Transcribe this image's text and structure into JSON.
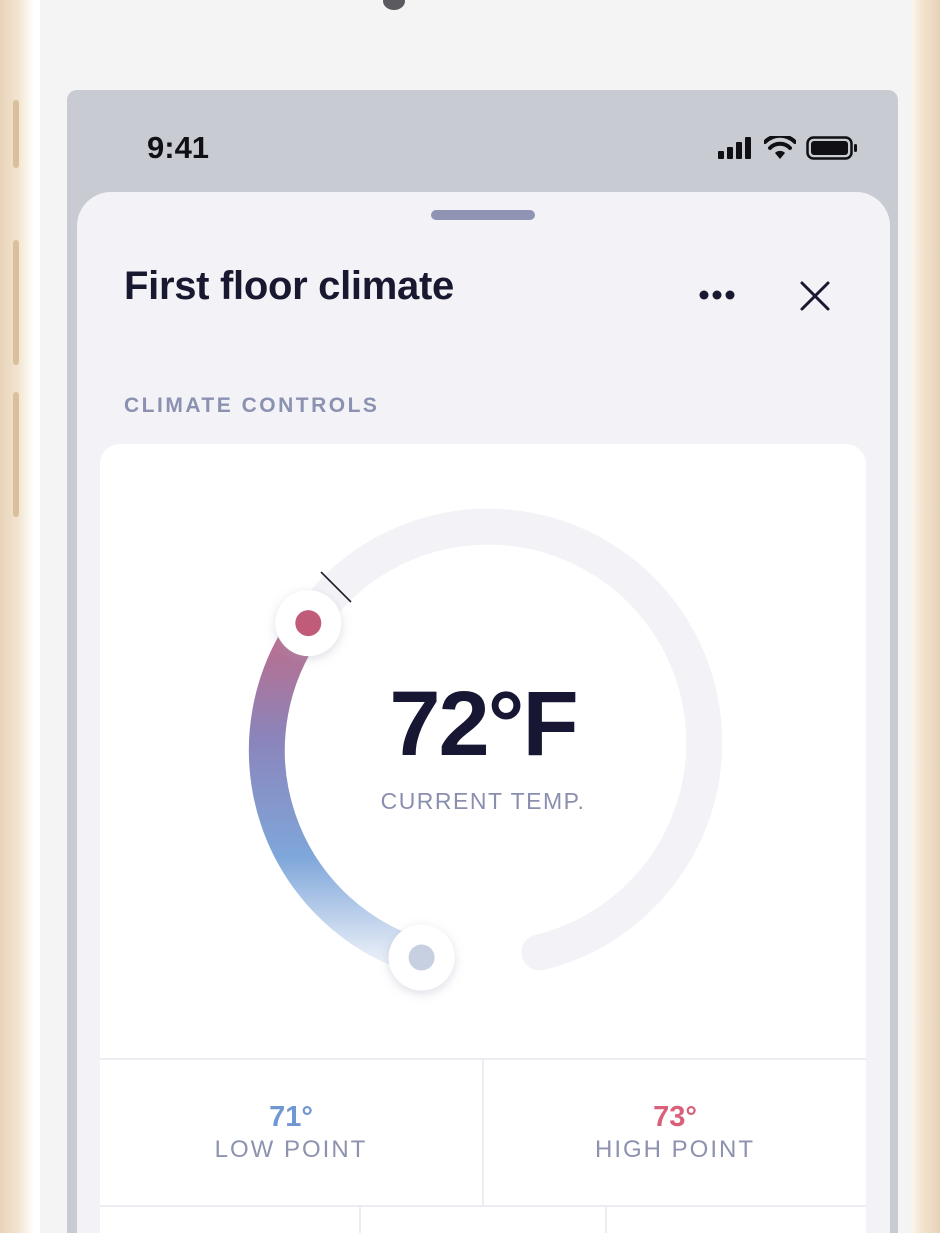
{
  "status": {
    "time": "9:41"
  },
  "sheet": {
    "title": "First floor climate"
  },
  "section": {
    "label": "CLIMATE CONTROLS"
  },
  "thermostat": {
    "current_temp": "72°F",
    "caption": "CURRENT TEMP.",
    "low": {
      "value": "71°",
      "label": "LOW POINT"
    },
    "high": {
      "value": "73°",
      "label": "HIGH POINT"
    }
  },
  "colors": {
    "low_accent": "#6f97d4",
    "high_accent": "#d9607a",
    "title": "#181830"
  },
  "icons": [
    "signal-icon",
    "wifi-icon",
    "battery-icon",
    "more-icon",
    "close-icon"
  ]
}
